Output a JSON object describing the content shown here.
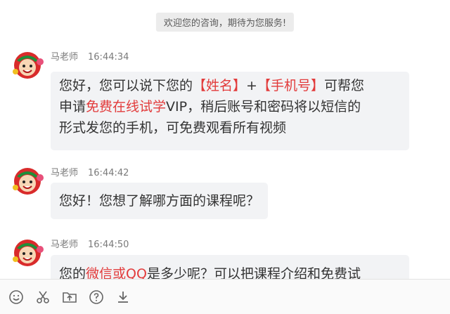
{
  "notice": "欢迎您的咨询，期待为您服务!",
  "messages": [
    {
      "sender": "马老师",
      "time": "16:44:34",
      "line1": {
        "a": "您好，您可以说下您的",
        "b": "【姓名】",
        "c": "+",
        "d": "【手机号】",
        "e": "可帮您"
      },
      "line2": {
        "a": "申请",
        "b": "免费在线试学",
        "c": "VIP，稍后账号和密码将以短信的"
      },
      "line3": "形式发您的手机，可免费观看所有视频"
    },
    {
      "sender": "马老师",
      "time": "16:44:42",
      "text": "您好！您想了解哪方面的课程呢？"
    },
    {
      "sender": "马老师",
      "time": "16:44:50",
      "a": "您的",
      "b": "微信或QQ",
      "c": "是多少呢？可以把课程介绍和免费试"
    }
  ],
  "toolbar": [
    "emoji-icon",
    "scissors-icon",
    "upload-folder-icon",
    "help-icon",
    "download-icon"
  ],
  "colors": {
    "highlight": "#e23b3b",
    "bubble": "#f2f3f5",
    "notice_bg": "#ececec"
  }
}
